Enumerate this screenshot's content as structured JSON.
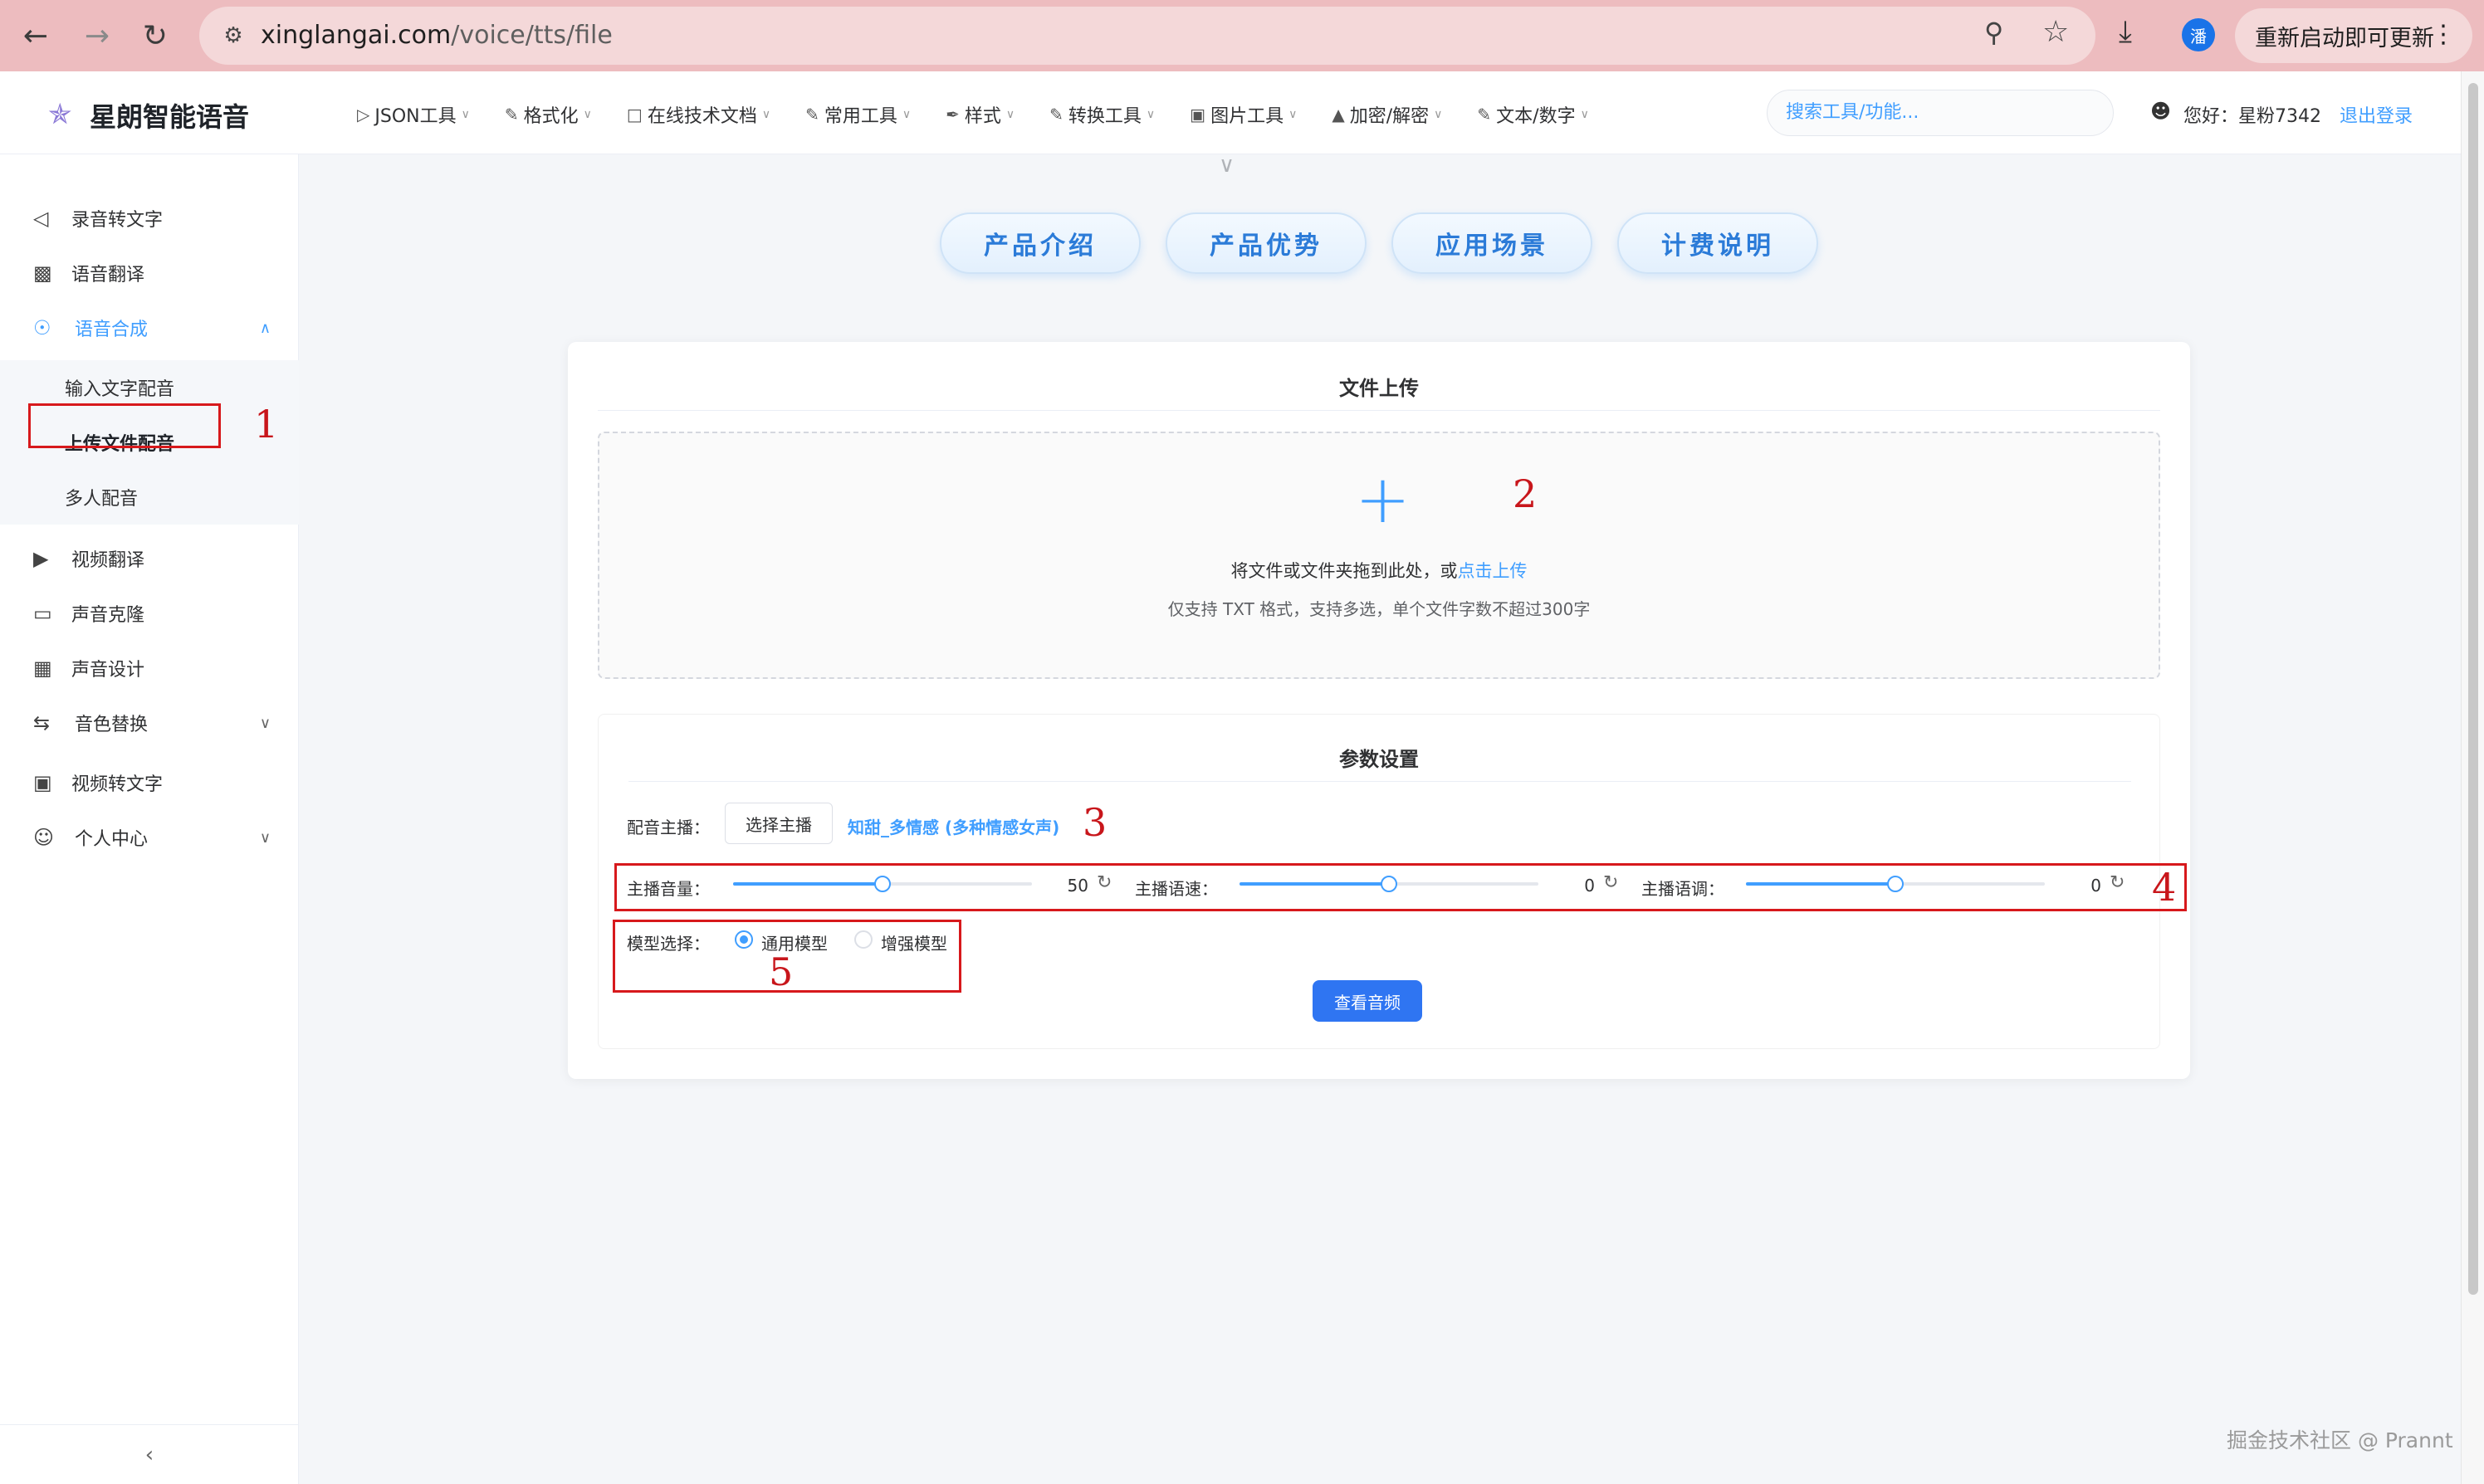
{
  "browser": {
    "url_host": "xinglangai.com",
    "url_path": "/voice/tts/file",
    "profile_initial": "潘",
    "update_label": "重新启动即可更新"
  },
  "header": {
    "brand": "星朗智能语音",
    "nav": [
      {
        "label": "JSON工具",
        "icon": "code-icon"
      },
      {
        "label": "格式化",
        "icon": "edit-icon"
      },
      {
        "label": "在线技术文档",
        "icon": "doc-icon"
      },
      {
        "label": "常用工具",
        "icon": "edit-icon"
      },
      {
        "label": "样式",
        "icon": "brush-icon"
      },
      {
        "label": "转换工具",
        "icon": "edit-icon"
      },
      {
        "label": "图片工具",
        "icon": "image-icon"
      },
      {
        "label": "加密/解密",
        "icon": "lock-icon"
      },
      {
        "label": "文本/数字",
        "icon": "edit-icon"
      }
    ],
    "search_placeholder": "搜索工具/功能...",
    "greeting": "您好：星粉7342",
    "logout": "退出登录"
  },
  "sidebar": {
    "items": [
      {
        "label": "录音转文字",
        "icon": "speaker-icon"
      },
      {
        "label": "语音翻译",
        "icon": "translate-icon"
      },
      {
        "label": "语音合成",
        "icon": "mic-icon"
      },
      {
        "label": "视频翻译",
        "icon": "video-play-icon"
      },
      {
        "label": "声音克隆",
        "icon": "clone-icon"
      },
      {
        "label": "声音设计",
        "icon": "design-icon"
      },
      {
        "label": "音色替换",
        "icon": "swap-icon"
      },
      {
        "label": "视频转文字",
        "icon": "video-icon"
      },
      {
        "label": "个人中心",
        "icon": "user-icon"
      }
    ],
    "sub_items": [
      {
        "label": "输入文字配音"
      },
      {
        "label": "上传文件配音"
      },
      {
        "label": "多人配音"
      }
    ]
  },
  "tabs": [
    {
      "label": "产品介绍"
    },
    {
      "label": "产品优势"
    },
    {
      "label": "应用场景"
    },
    {
      "label": "计费说明"
    }
  ],
  "upload": {
    "title": "文件上传",
    "drop_text": "将文件或文件夹拖到此处，或",
    "drop_link": "点击上传",
    "tip": "仅支持 TXT 格式，支持多选，单个文件字数不超过300字"
  },
  "params": {
    "title": "参数设置",
    "voice_label": "配音主播：",
    "choose_voice": "选择主播",
    "voice_name": "知甜_多情感 (多种情感女声)",
    "sliders": [
      {
        "label": "主播音量：",
        "value": "50",
        "fraction": 0.5
      },
      {
        "label": "主播语速：",
        "value": "0",
        "fraction": 0.5
      },
      {
        "label": "主播语调：",
        "value": "0",
        "fraction": 0.5
      }
    ],
    "model_label": "模型选择：",
    "models": [
      {
        "label": "通用模型",
        "checked": true
      },
      {
        "label": "增强模型",
        "checked": false
      }
    ],
    "view_audio": "查看音频"
  },
  "annotations": [
    "1",
    "2",
    "3",
    "4",
    "5"
  ],
  "watermark": "掘金技术社区 @ Prannt",
  "colors": {
    "accent": "#409eff",
    "annotation": "#d7191c",
    "chrome": "#edbcbf"
  }
}
